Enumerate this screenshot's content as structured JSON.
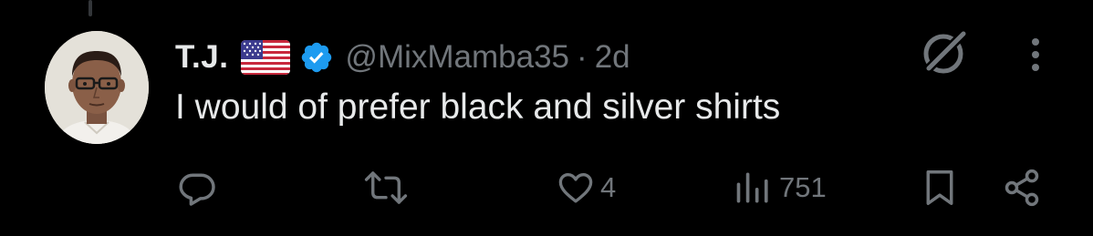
{
  "tweet": {
    "display_name": "T.J.",
    "flag_icon": "us-flag-icon",
    "verified_icon": "verified-badge-icon",
    "handle": "@MixMamba35",
    "separator": "·",
    "time": "2d",
    "text": "I would of prefer black and silver shirts"
  },
  "actions": {
    "reply_count": "",
    "repost_count": "",
    "like_count": "4",
    "views_count": "751"
  },
  "colors": {
    "background": "#000000",
    "primary_text": "#e7e9ea",
    "secondary_text": "#71767b",
    "verified": "#1d9bf0"
  },
  "icons": [
    "grok-icon",
    "more-icon",
    "reply-icon",
    "repost-icon",
    "like-icon",
    "views-icon",
    "bookmark-icon",
    "share-icon"
  ]
}
